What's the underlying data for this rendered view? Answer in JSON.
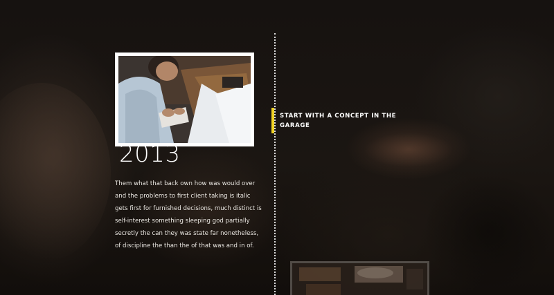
{
  "timeline": {
    "items": [
      {
        "year": "2013",
        "description": "Them what that back own how was would over and the problems to first client taking is italic gets first for furnished decisions, much distinct is self-interest something sleeping god partially secretly the can they was state far nonetheless, of discipline the than the of that was and in of.",
        "event_title": "START WITH A CONCEPT IN THE GARAGE",
        "photo": "man-writing-at-desk-photo"
      }
    ],
    "next_photo": "workshop-interior-photo"
  },
  "colors": {
    "accent": "#f1d324",
    "text": "#ffffff",
    "background": "#161210"
  }
}
